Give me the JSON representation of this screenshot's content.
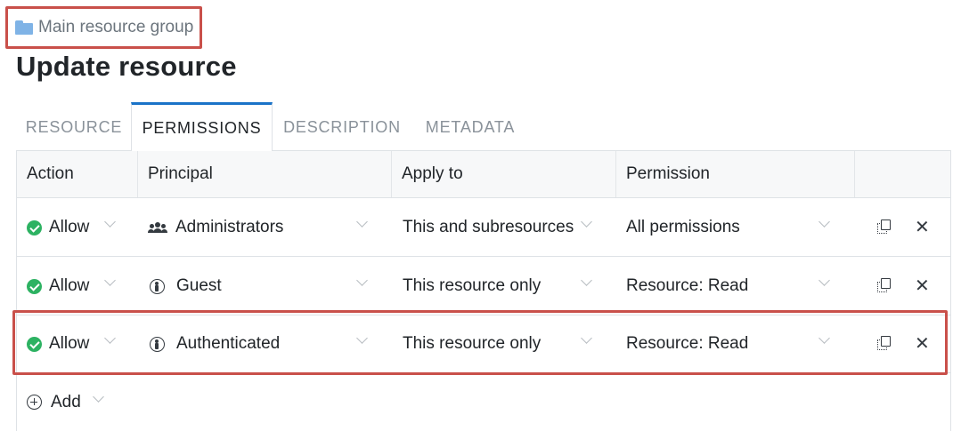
{
  "breadcrumb": {
    "label": "Main resource group",
    "icon": "folder-icon"
  },
  "page": {
    "title": "Update resource"
  },
  "tabs": [
    {
      "label": "RESOURCE",
      "active": false
    },
    {
      "label": "PERMISSIONS",
      "active": true
    },
    {
      "label": "DESCRIPTION",
      "active": false
    },
    {
      "label": "METADATA",
      "active": false
    }
  ],
  "table": {
    "headers": {
      "action": "Action",
      "principal": "Principal",
      "apply_to": "Apply to",
      "permission": "Permission"
    },
    "rows": [
      {
        "action": "Allow",
        "principal": "Administrators",
        "principal_icon": "group-icon",
        "apply_to": "This and subresources",
        "permission": "All permissions"
      },
      {
        "action": "Allow",
        "principal": "Guest",
        "principal_icon": "user-circle-icon",
        "apply_to": "This resource only",
        "permission": "Resource: Read"
      },
      {
        "action": "Allow",
        "principal": "Authenticated",
        "principal_icon": "user-circle-icon",
        "apply_to": "This resource only",
        "permission": "Resource: Read"
      }
    ],
    "add_label": "Add"
  },
  "colors": {
    "accent": "#1a73c8",
    "allow": "#2db262",
    "highlight": "#c9504a",
    "folder": "#7fb3e6"
  }
}
